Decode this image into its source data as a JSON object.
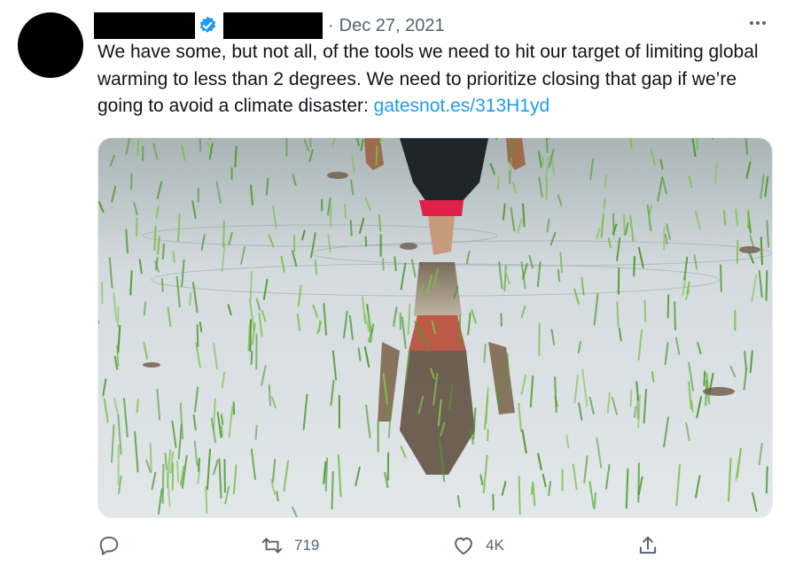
{
  "tweet": {
    "date": "Dec 27, 2021",
    "separator": "·",
    "text_main": "We have some, but not all, of the tools we need to hit our target of limiting global warming to less than 2 degrees. We need to prioritize closing that gap if we’re going to avoid a climate disaster: ",
    "link_text": "gatesnot.es/313H1yd",
    "media_icon": "photo-rice-paddy-farmer",
    "verified_color": "#1d9bf0"
  },
  "actions": {
    "reply_count": "",
    "retweet_count": "719",
    "like_count": "4K",
    "share_count": ""
  },
  "colors": {
    "link": "#1d9bf0",
    "secondary_text": "#536471",
    "water": "#c9d2d8",
    "grass": "#5a9a3a"
  }
}
